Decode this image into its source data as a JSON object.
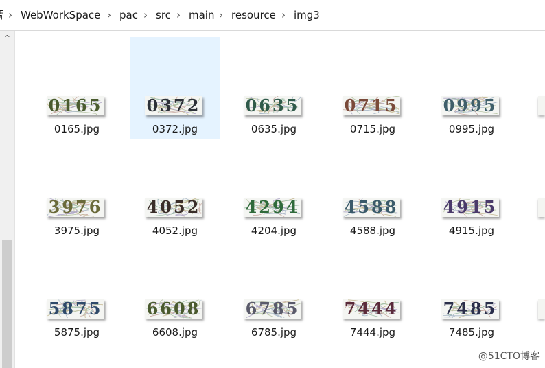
{
  "breadcrumb": {
    "items": [
      "WebWorkSpace",
      "pac",
      "src",
      "main",
      "resource",
      "img3"
    ],
    "separator": "›"
  },
  "scrollbar": {
    "up_arrow": "^"
  },
  "files": [
    {
      "name": "0165.jpg",
      "captcha": "0165",
      "color": "#4a5b2e",
      "selected": false
    },
    {
      "name": "0372.jpg",
      "captcha": "0372",
      "color": "#2d3138",
      "selected": true
    },
    {
      "name": "0635.jpg",
      "captcha": "0635",
      "color": "#2f5a4a",
      "selected": false
    },
    {
      "name": "0715.jpg",
      "captcha": "0715",
      "color": "#7a4a3a",
      "selected": false
    },
    {
      "name": "0995.jpg",
      "captcha": "0995",
      "color": "#3f5f6a",
      "selected": false
    },
    {
      "name": "3975.jpg",
      "captcha": "3976",
      "color": "#6a6a3a",
      "selected": false
    },
    {
      "name": "4052.jpg",
      "captcha": "4052",
      "color": "#3a2e2a",
      "selected": false
    },
    {
      "name": "4204.jpg",
      "captcha": "4294",
      "color": "#2f6a3a",
      "selected": false
    },
    {
      "name": "4588.jpg",
      "captcha": "4588",
      "color": "#3a5a6a",
      "selected": false
    },
    {
      "name": "4915.jpg",
      "captcha": "4915",
      "color": "#4a3a6a",
      "selected": false
    },
    {
      "name": "5875.jpg",
      "captcha": "5875",
      "color": "#2f4a6a",
      "selected": false
    },
    {
      "name": "6608.jpg",
      "captcha": "6608",
      "color": "#4a5a2e",
      "selected": false
    },
    {
      "name": "6785.jpg",
      "captcha": "6785",
      "color": "#5a5a6a",
      "selected": false
    },
    {
      "name": "7444.jpg",
      "captcha": "7444",
      "color": "#5a2a3a",
      "selected": false
    },
    {
      "name": "7485.jpg",
      "captcha": "7485",
      "color": "#2a2e4a",
      "selected": false
    }
  ],
  "watermark": "@51CTO博客"
}
